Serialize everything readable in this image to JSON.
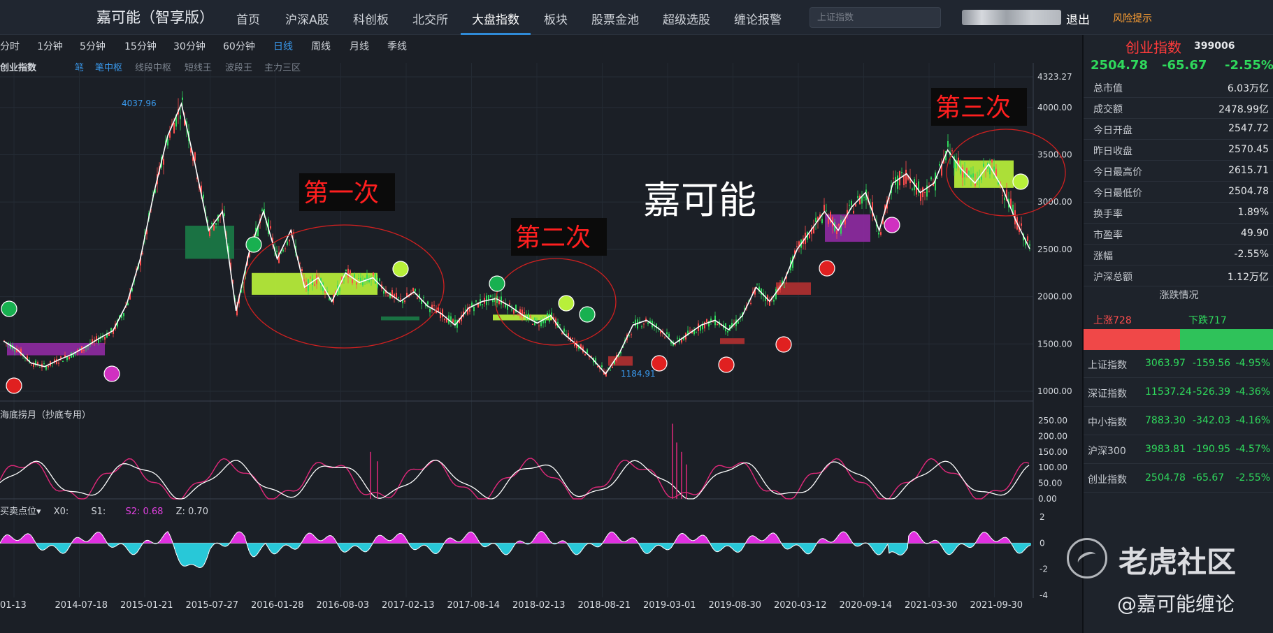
{
  "brand": "嘉可能（智享版）",
  "nav": [
    "首页",
    "沪深A股",
    "科创板",
    "北交所",
    "大盘指数",
    "板块",
    "股票金池",
    "超级选股",
    "缠论报警"
  ],
  "nav_active": "大盘指数",
  "search": {
    "placeholder": "上证指数"
  },
  "logout": "退出",
  "risk": "风险提示",
  "periods": [
    "分时",
    "1分钟",
    "5分钟",
    "15分钟",
    "30分钟",
    "60分钟",
    "日线",
    "周线",
    "月线",
    "季线"
  ],
  "period_active": "日线",
  "indicator": {
    "title": "创业指数",
    "options": [
      "笔",
      "笔中枢",
      "线段中枢",
      "短线王",
      "波段王",
      "主力三区"
    ],
    "on": [
      "笔",
      "笔中枢"
    ]
  },
  "annotations": {
    "first": "第一次",
    "second": "第二次",
    "third": "第三次",
    "watermark_center": "嘉可能"
  },
  "marks": {
    "high_label": "4037.96",
    "low_label": "1184.91"
  },
  "panels": {
    "sub1_title": "海底捞月（抄底专用）",
    "sub2_title": "买卖点位",
    "sub2_x": "X0:",
    "sub2_s1": "S1:",
    "sub2_s2": "S2:",
    "sub2_s2_value": "0.68",
    "sub2_z": "Z:",
    "sub2_z_value": "0.70"
  },
  "colors": {
    "up": "#ff4d4d",
    "down": "#2fd95c",
    "accent": "#3a9bf0",
    "zone_yellow": "#b8f03a",
    "zone_purple": "#8d2aa0",
    "zone_green": "#1a7a45"
  },
  "chart_data": {
    "type": "line",
    "title": "创业指数",
    "x_ticks": [
      "01-13",
      "2014-07-18",
      "2015-01-21",
      "2015-07-27",
      "2016-01-28",
      "2016-08-03",
      "2017-02-13",
      "2017-08-14",
      "2018-02-13",
      "2018-08-21",
      "2019-03-01",
      "2019-08-30",
      "2020-03-12",
      "2020-09-14",
      "2021-03-30",
      "2021-09-30"
    ],
    "y_ticks": [
      1000.0,
      1500.0,
      2000.0,
      2500.0,
      3000.0,
      3500.0,
      4000.0,
      4323.27
    ],
    "ylim": [
      1000,
      4323.27
    ],
    "series": [
      {
        "values": [
          1530,
          1440,
          1300,
          1260,
          1330,
          1390,
          1470,
          1560,
          1640,
          1920,
          2400,
          3100,
          3700,
          4037.96,
          3400,
          2700,
          2900,
          1850,
          2500,
          2900,
          2400,
          2700,
          2100,
          2200,
          1950,
          2250,
          2150,
          2200,
          2050,
          1950,
          2050,
          1900,
          1820,
          1700,
          1880,
          1950,
          1980,
          1900,
          1800,
          1720,
          1800,
          1600,
          1480,
          1350,
          1184.91,
          1400,
          1700,
          1750,
          1650,
          1500,
          1600,
          1700,
          1750,
          1650,
          1800,
          2100,
          1950,
          2150,
          2500,
          2700,
          2900,
          2700,
          2950,
          3100,
          2700,
          3200,
          3300,
          3100,
          3200,
          3550,
          3350,
          3200,
          3400,
          3150,
          2800,
          2504.78
        ]
      }
    ],
    "sub1": {
      "y_ticks": [
        0.0,
        50.0,
        100.0,
        150.0,
        200.0,
        250.0
      ],
      "ylim": [
        0,
        250
      ]
    },
    "sub2": {
      "y_ticks": [
        -4,
        -2,
        0,
        2
      ],
      "ylim": [
        -4,
        2
      ]
    }
  },
  "side": {
    "name": "创业指数",
    "code": "399006",
    "price": "2504.78",
    "change": "-65.67",
    "pct": "-2.55%",
    "stats": [
      {
        "k": "总市值",
        "v": "6.03万亿"
      },
      {
        "k": "成交额",
        "v": "2478.99亿"
      },
      {
        "k": "今日开盘",
        "v": "2547.72"
      },
      {
        "k": "昨日收盘",
        "v": "2570.45"
      },
      {
        "k": "今日最高价",
        "v": "2615.71"
      },
      {
        "k": "今日最低价",
        "v": "2504.78"
      },
      {
        "k": "换手率",
        "v": "1.89%"
      },
      {
        "k": "市盈率",
        "v": "49.90"
      },
      {
        "k": "涨幅",
        "v": "-2.55%"
      },
      {
        "k": "沪深总额",
        "v": "1.12万亿"
      }
    ],
    "updown_title": "涨跌情况",
    "up": "上涨728",
    "down": "下跌717",
    "up_count": 728,
    "down_count": 717,
    "indices": [
      {
        "n": "上证指数",
        "p": "3063.97",
        "c": "-159.56",
        "r": "-4.95%"
      },
      {
        "n": "深证指数",
        "p": "11537.24",
        "c": "-526.39",
        "r": "-4.36%"
      },
      {
        "n": "中小指数",
        "p": "7883.30",
        "c": "-342.03",
        "r": "-4.16%"
      },
      {
        "n": "沪深300",
        "p": "3983.81",
        "c": "-190.95",
        "r": "-4.57%"
      },
      {
        "n": "创业指数",
        "p": "2504.78",
        "c": "-65.67",
        "r": "-2.55%"
      }
    ]
  },
  "watermark": {
    "site": "老虎社区",
    "author": "@嘉可能缠论"
  }
}
